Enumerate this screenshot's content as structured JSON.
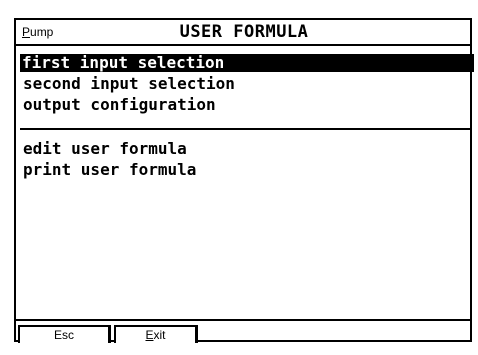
{
  "header": {
    "left_label_initial": "P",
    "left_label_rest": "ump",
    "title": "USER FORMULA"
  },
  "menu": {
    "items": [
      {
        "label": "first input selection",
        "selected": true
      },
      {
        "label": "second input selection",
        "selected": false
      },
      {
        "label": "output configuration",
        "selected": false
      }
    ],
    "items2": [
      {
        "label": "edit user formula"
      },
      {
        "label": "print user formula"
      }
    ]
  },
  "buttons": {
    "esc_label": "Esc",
    "exit_initial": "E",
    "exit_rest": "xit"
  },
  "colors": {
    "foreground": "#000000",
    "background": "#ffffff",
    "selection_bg": "#000000",
    "selection_fg": "#ffffff"
  }
}
